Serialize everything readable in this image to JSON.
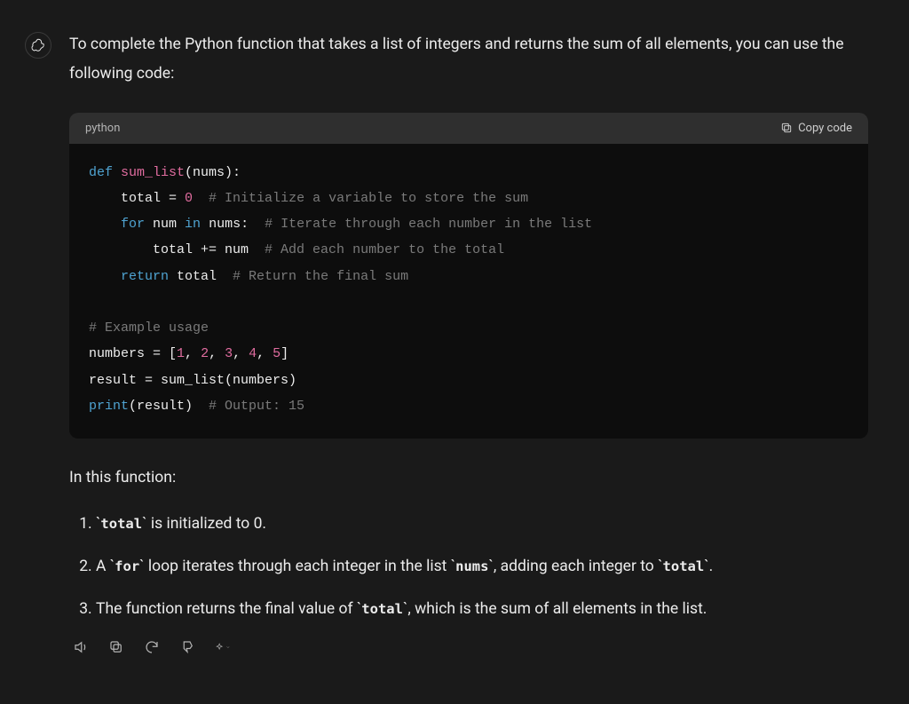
{
  "intro": "To complete the Python function that takes a list of integers and returns the sum of all elements, you can use the following code:",
  "code_header": {
    "language": "python",
    "copy_label": "Copy code"
  },
  "code": {
    "t_def": "def ",
    "t_fn": "sum_list",
    "t_paren_nums": "(nums):",
    "l2_a": "    total = ",
    "l2_num": "0",
    "l2_c": "  # Initialize a variable to store the sum",
    "l3_a": "    ",
    "l3_for": "for",
    "l3_b": " num ",
    "l3_in": "in",
    "l3_c": " nums:  ",
    "l3_cm": "# Iterate through each number in the list",
    "l4_a": "        total += num  ",
    "l4_cm": "# Add each number to the total",
    "l5_a": "    ",
    "l5_ret": "return",
    "l5_b": " total  ",
    "l5_cm": "# Return the final sum",
    "l6": "",
    "l7_cm": "# Example usage",
    "l8_a": "numbers = [",
    "l8_n1": "1",
    "l8_s1": ", ",
    "l8_n2": "2",
    "l8_s2": ", ",
    "l8_n3": "3",
    "l8_s3": ", ",
    "l8_n4": "4",
    "l8_s4": ", ",
    "l8_n5": "5",
    "l8_b": "]",
    "l9": "result = sum_list(numbers)",
    "l10_a": "print",
    "l10_b": "(result)  ",
    "l10_cm": "# Output: 15"
  },
  "outro": "In this function:",
  "items": {
    "i1_a": "`",
    "i1_code": "total",
    "i1_b": "` is initialized to 0.",
    "i2_a": "A `",
    "i2_code1": "for",
    "i2_b": "` loop iterates through each integer in the list `",
    "i2_code2": "nums",
    "i2_c": "`, adding each integer to `",
    "i2_code3": "total",
    "i2_d": "`.",
    "i3_a": "The function returns the final value of `",
    "i3_code": "total",
    "i3_b": "`, which is the sum of all elements in the list."
  }
}
